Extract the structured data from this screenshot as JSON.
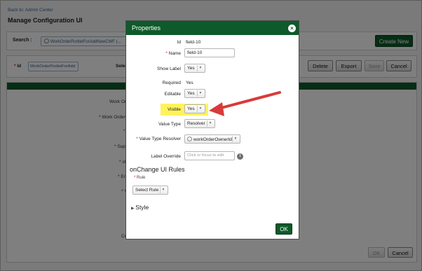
{
  "background": {
    "back_link": "Back to: Admin Center",
    "page_title": "Manage Configuration UI",
    "search_label": "Search :",
    "search_value": "WorkOrderPortletForAddNewCWF (...",
    "create_button": "Create New",
    "id_label": "Id",
    "id_value": "WorkOrderPortletForAdd",
    "select_label": "Select I",
    "buttons": {
      "delete": "Delete",
      "export": "Export",
      "save": "Save",
      "cancel": "Cancel"
    },
    "field_labels": [
      "Work Or",
      "* Work Order",
      "*",
      "* Sup",
      "* sta",
      "* En",
      "* V",
      "Cu"
    ],
    "ok_button": "OK",
    "cancel_button": "Cancel"
  },
  "modal": {
    "title": "Properties",
    "close_icon": "close-icon",
    "fields": {
      "id": {
        "label": "Id",
        "value": "field-10"
      },
      "name": {
        "label": "Name",
        "value": "field-10"
      },
      "show_label": {
        "label": "Show Label",
        "value": "Yes"
      },
      "required": {
        "label": "Required",
        "value": "Yes"
      },
      "editable": {
        "label": "Editable",
        "value": "Yes"
      },
      "visible": {
        "label": "Visible",
        "value": "Yes"
      },
      "value_type": {
        "label": "Value Type",
        "value": "Resolver"
      },
      "value_type_resolver": {
        "label": "Value Type Resolver",
        "value": "workOrderOwnerId"
      },
      "label_override": {
        "label": "Label Override",
        "placeholder": "Click or focus to edit"
      }
    },
    "on_change_title": "onChange UI Rules",
    "rule_label": "Rule",
    "rule_select": "Select Rule",
    "style_section": "Style",
    "ok_button": "OK"
  },
  "annotation": {
    "arrow_color": "#d93a3a",
    "highlight_color": "#fff35c"
  }
}
